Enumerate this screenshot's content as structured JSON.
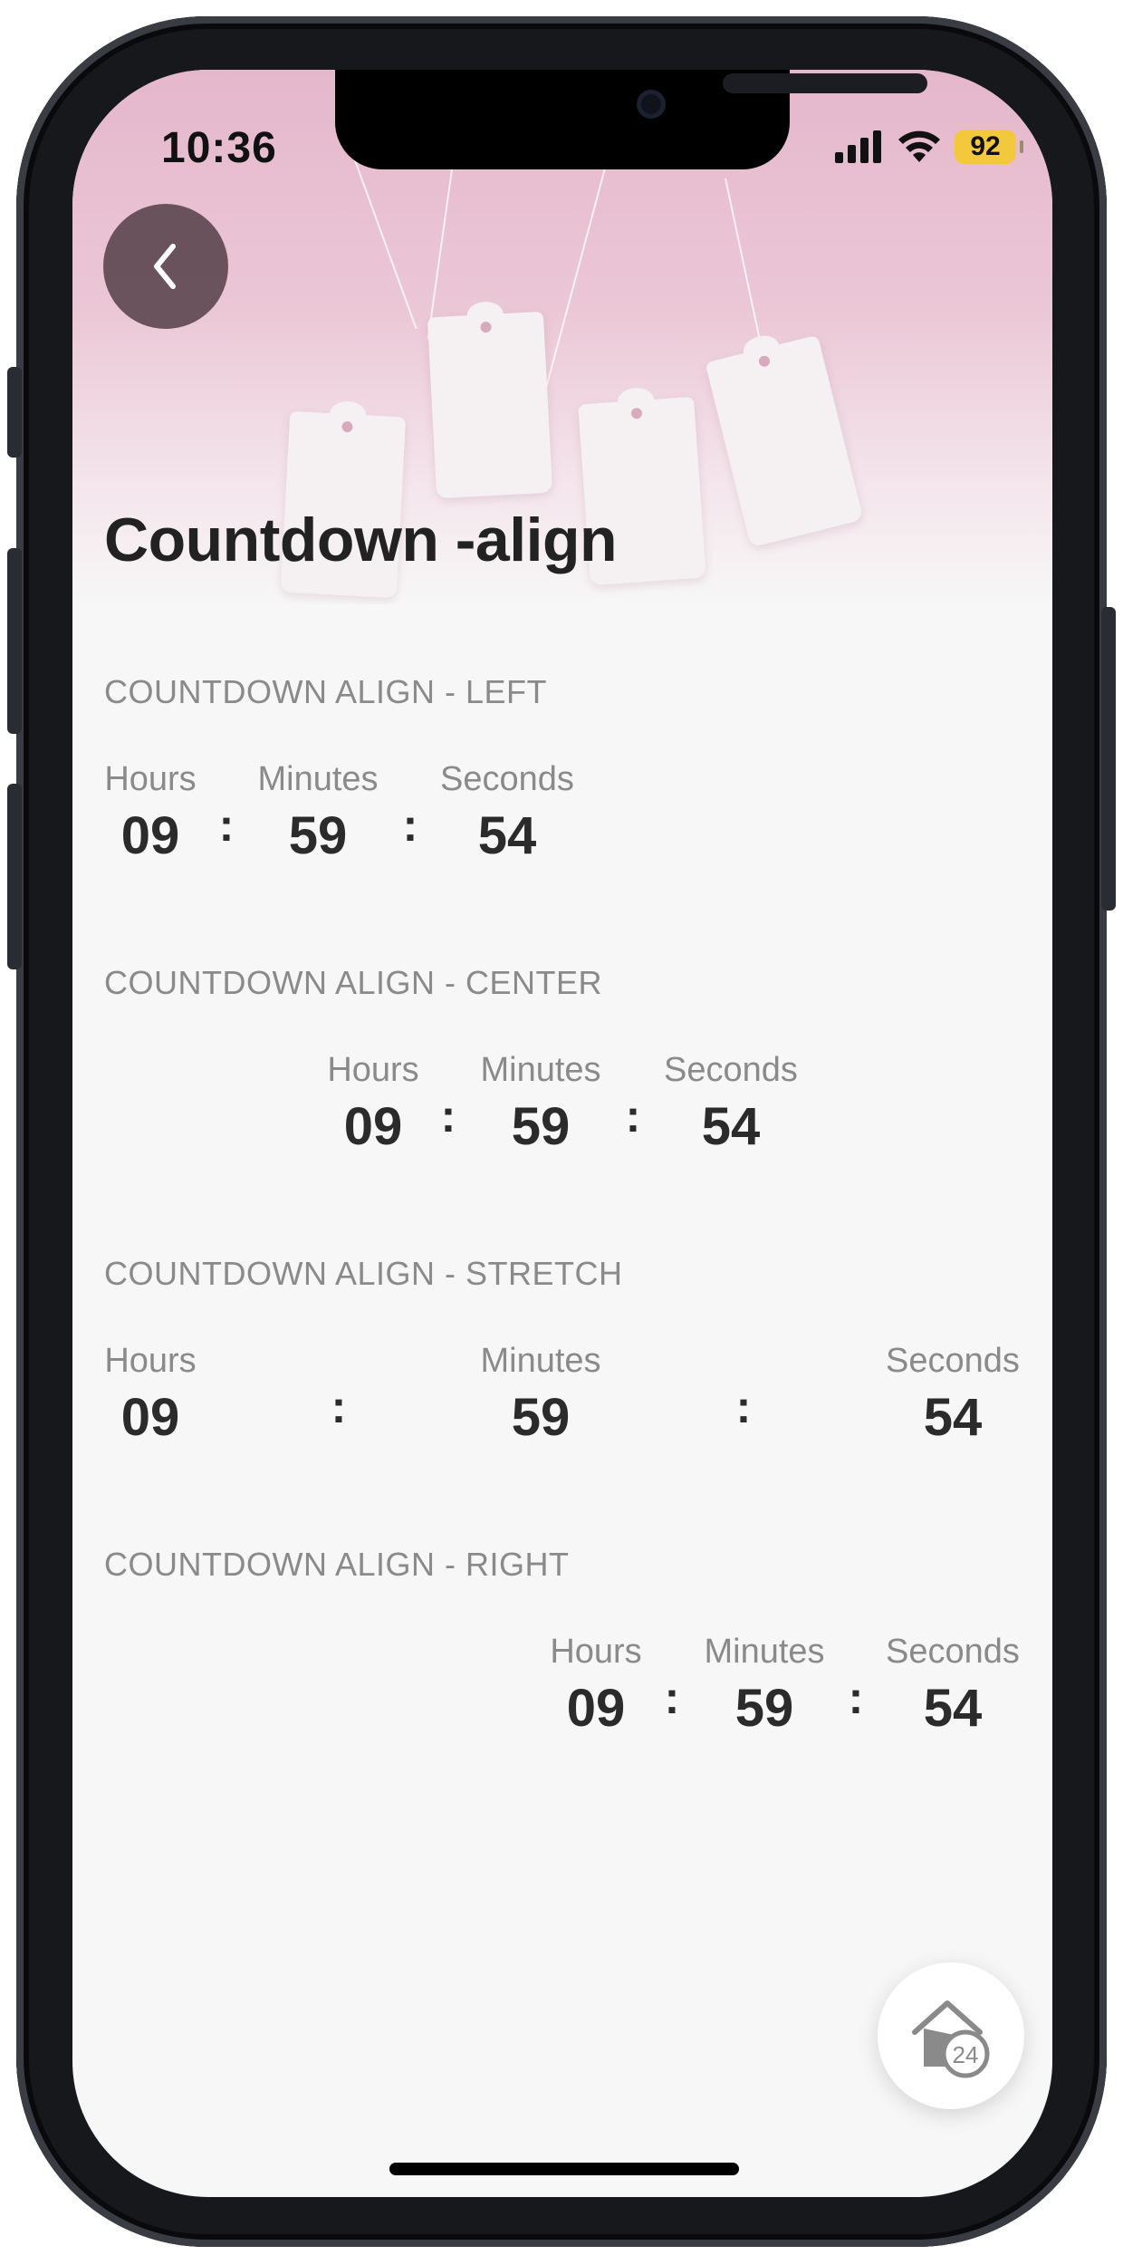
{
  "status_bar": {
    "time": "10:36",
    "battery": "92"
  },
  "header": {
    "title": "Countdown -align",
    "back_icon": "chevron-left-icon"
  },
  "sections": [
    {
      "label": "COUNTDOWN ALIGN - LEFT",
      "alignment": "left",
      "units": [
        {
          "label": "Hours",
          "value": "09"
        },
        {
          "label": "Minutes",
          "value": "59"
        },
        {
          "label": "Seconds",
          "value": "54"
        }
      ],
      "separator": ":"
    },
    {
      "label": "COUNTDOWN ALIGN - CENTER",
      "alignment": "center",
      "units": [
        {
          "label": "Hours",
          "value": "09"
        },
        {
          "label": "Minutes",
          "value": "59"
        },
        {
          "label": "Seconds",
          "value": "54"
        }
      ],
      "separator": ":"
    },
    {
      "label": "COUNTDOWN ALIGN - STRETCH",
      "alignment": "stretch",
      "units": [
        {
          "label": "Hours",
          "value": "09"
        },
        {
          "label": "Minutes",
          "value": "59"
        },
        {
          "label": "Seconds",
          "value": "54"
        }
      ],
      "separator": ":"
    },
    {
      "label": "COUNTDOWN ALIGN - RIGHT",
      "alignment": "right",
      "units": [
        {
          "label": "Hours",
          "value": "09"
        },
        {
          "label": "Minutes",
          "value": "59"
        },
        {
          "label": "Seconds",
          "value": "54"
        }
      ],
      "separator": ":"
    }
  ],
  "fab": {
    "icon": "home-24-icon",
    "badge": "24"
  },
  "colors": {
    "hero_pink": "#e5b7cc",
    "text_dark": "#2b2b2b",
    "label_gray": "#8a8a8a",
    "battery": "#f3c83d"
  }
}
